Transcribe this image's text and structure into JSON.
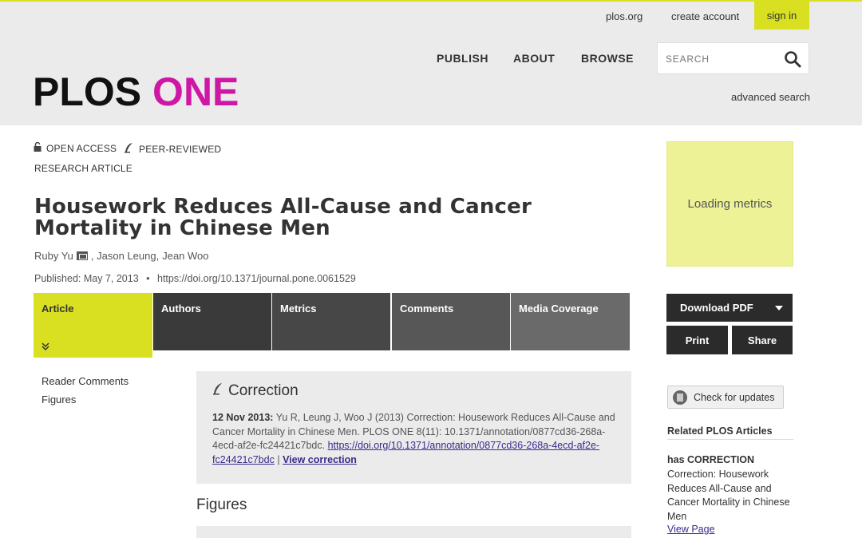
{
  "header": {
    "util_links": [
      "plos.org",
      "create account"
    ],
    "signin_label": "sign in",
    "nav": [
      "PUBLISH",
      "ABOUT",
      "BROWSE"
    ],
    "search_placeholder": "SEARCH",
    "advanced_search": "advanced search",
    "logo_part1": "PLOS",
    "logo_part2": "ONE"
  },
  "colors": {
    "accent": "#d9e021",
    "logo_magenta": "#cf17a6",
    "dark_button": "#2b2b2b",
    "metrics_bg": "#eef296"
  },
  "article": {
    "badges": [
      "OPEN ACCESS",
      "PEER-REVIEWED"
    ],
    "type": "RESEARCH ARTICLE",
    "title": "Housework Reduces All-Cause and Cancer Mortality in Chinese Men",
    "authors": [
      "Ruby Yu",
      ", Jason Leung,",
      "Jean Woo"
    ],
    "published": "Published: May 7, 2013",
    "bullet": "•",
    "doi": "https://doi.org/10.1371/journal.pone.0061529"
  },
  "tabs": [
    "Article",
    "Authors",
    "Metrics",
    "Comments",
    "Media Coverage"
  ],
  "left_nav": [
    "Reader Comments",
    "Figures"
  ],
  "correction": {
    "heading": "Correction",
    "date": "12 Nov 2013:",
    "text": "Yu R, Leung J, Woo J (2013) Correction: Housework Reduces All-Cause and Cancer Mortality in Chinese Men. PLOS ONE 8(11): 10.1371/annotation/0877cd36-268a-4ecd-af2e-fc24421c7bdc.",
    "link": "https://doi.org/10.1371/annotation/0877cd36-268a-4ecd-af2e-fc24421c7bdc",
    "separator": "|",
    "view_label": "View correction"
  },
  "figures_heading": "Figures",
  "sidebar": {
    "metrics_text": "Loading metrics",
    "download_label": "Download PDF",
    "print_label": "Print",
    "share_label": "Share",
    "check_updates": "Check for updates",
    "related_heading": "Related PLOS Articles",
    "related_type": "has CORRECTION",
    "related_title": "Correction: Housework Reduces All-Cause and Cancer Mortality in Chinese Men",
    "related_link": "View Page"
  }
}
